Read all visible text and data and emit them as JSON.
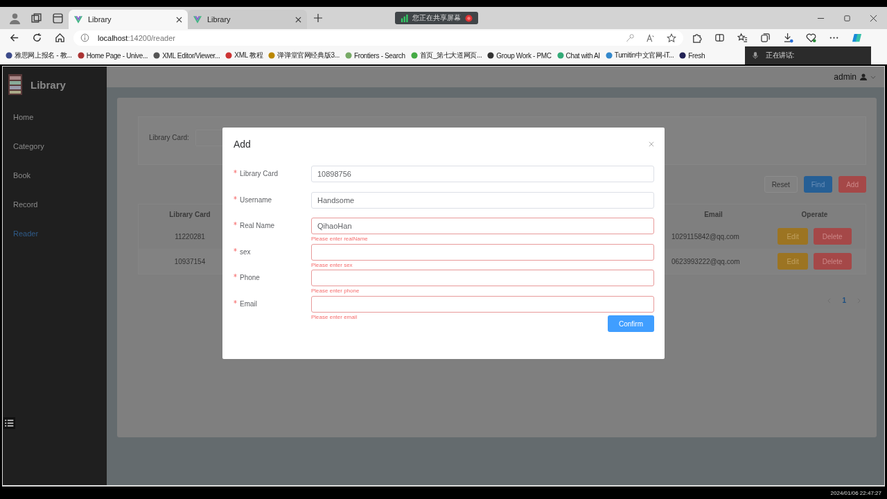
{
  "browser": {
    "tabs": [
      {
        "title": "Library",
        "selected": true
      },
      {
        "title": "Library",
        "selected": false
      }
    ],
    "share_banner": "您正在共享屏幕",
    "address": {
      "host": "localhost",
      "path": ":14200/reader"
    },
    "bookmarks": [
      "雅思网上报名 - 教...",
      "Home Page - Unive...",
      "XML Editor/Viewer...",
      "XML 教程",
      "弹弹堂官网经典版3...",
      "Frontiers - Search",
      "首页_第七大道网页...",
      "Group Work - PMC",
      "Chat with AI",
      "Turnitin中文官网-iT...",
      "Fresh"
    ],
    "speaking_label": "正在讲话:"
  },
  "app": {
    "brand": "Library",
    "nav": [
      {
        "label": "Home",
        "selected": false
      },
      {
        "label": "Category",
        "selected": false
      },
      {
        "label": "Book",
        "selected": false
      },
      {
        "label": "Record",
        "selected": false
      },
      {
        "label": "Reader",
        "selected": true
      }
    ],
    "user": "admin",
    "search": {
      "label": "Library Card:"
    },
    "buttons": [
      {
        "label": "Reset",
        "kind": "plain"
      },
      {
        "label": "Find",
        "kind": "primary"
      },
      {
        "label": "Add",
        "kind": "danger"
      }
    ],
    "table": {
      "columns": [
        "Library Card",
        "Email",
        "Operate"
      ],
      "rows": [
        {
          "card": "11220281",
          "email": "1029115842@qq.com",
          "actions": [
            {
              "label": "Edit",
              "kind": "warning"
            },
            {
              "label": "Delete",
              "kind": "danger"
            }
          ]
        },
        {
          "card": "10937154",
          "email": "0623993222@qq.com",
          "actions": [
            {
              "label": "Edit",
              "kind": "warning"
            },
            {
              "label": "Delete",
              "kind": "danger"
            }
          ]
        }
      ]
    },
    "pagination": [
      {
        "label": "1",
        "selected": true
      }
    ]
  },
  "dialog": {
    "title": "Add",
    "fields": [
      {
        "label": "Library Card",
        "value": "10898756",
        "required": true
      },
      {
        "label": "Username",
        "value": "Handsome",
        "required": true
      },
      {
        "label": "Real Name",
        "value": "QihaoHan",
        "required": true,
        "error": "Please enter realName"
      },
      {
        "label": "sex",
        "required": true,
        "error": "Please enter sex"
      },
      {
        "label": "Phone",
        "required": true,
        "error": "Please enter phone"
      },
      {
        "label": "Email",
        "required": true,
        "error": "Please enter email"
      }
    ],
    "confirm": "Confirm"
  },
  "timestamp": "2024/01/06 22:47:27"
}
